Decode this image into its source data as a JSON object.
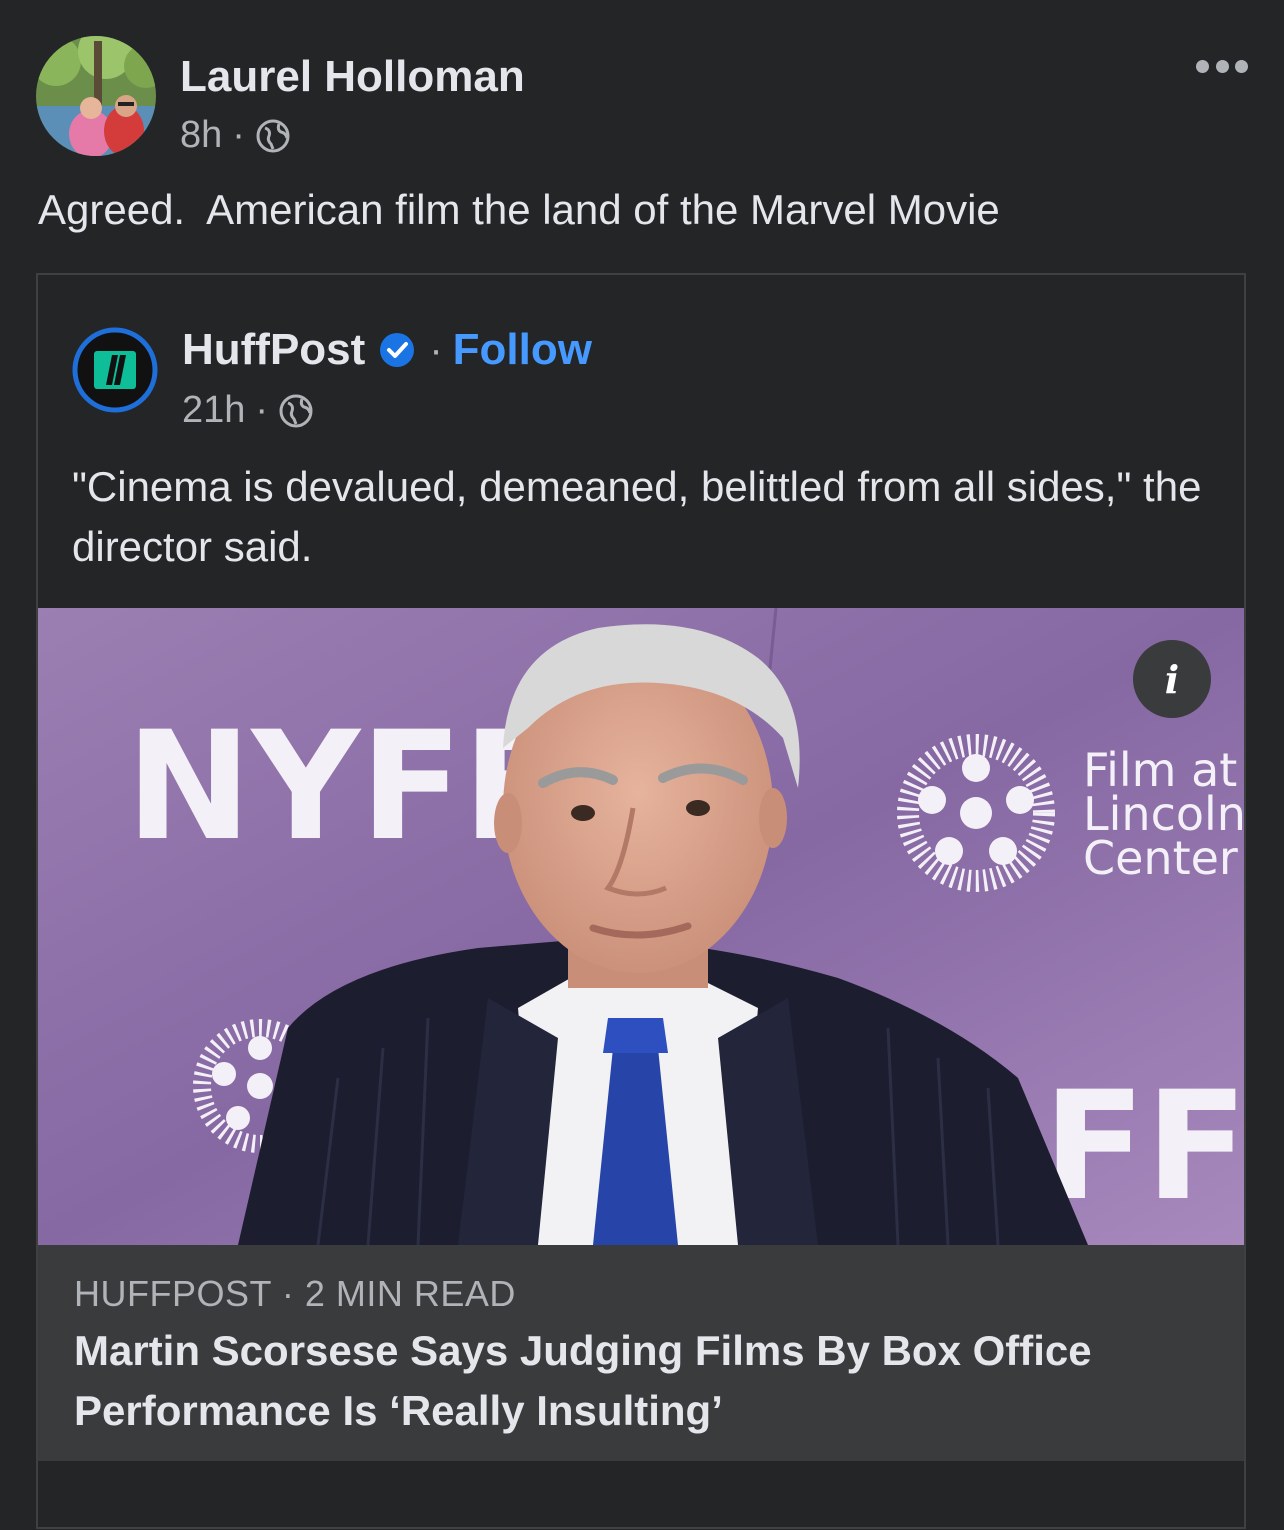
{
  "post": {
    "author": "Laurel Holloman",
    "time": "8h",
    "separator": "·",
    "privacy_icon": "globe-icon",
    "text": "Agreed.  American film the land of the Marvel Movie"
  },
  "shared_post": {
    "page_name": "HuffPost",
    "verified_icon": "verified-badge-icon",
    "separator": "·",
    "follow_label": "Follow",
    "time": "21h",
    "privacy_icon": "globe-icon",
    "text": "\"Cinema is devalued, demeaned, belittled from all sides,\" the director said.",
    "image": {
      "backdrop_text_left": "NYFF",
      "backdrop_text_right_1": "Film at",
      "backdrop_text_right_2": "Lincoln",
      "backdrop_text_right_3": "Center",
      "backdrop_text_lower": "FF",
      "info_glyph": "i"
    },
    "link": {
      "source": "HUFFPOST · 2 MIN READ",
      "title": "Martin Scorsese Says Judging Films By Box Office Performance Is ‘Really Insulting’"
    }
  },
  "colors": {
    "background": "#242526",
    "link_blue": "#4599ff",
    "card_footer": "#3a3b3c",
    "huffpost_green": "#0dbe98"
  }
}
